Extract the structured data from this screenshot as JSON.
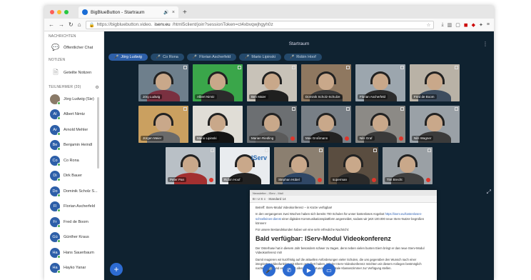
{
  "browser": {
    "tab_title": "BigBlueButton - Startraum",
    "new_tab": "+",
    "url_prefix": "https://bigbluebutton.video.",
    "url_domain": "iserv.eu",
    "url_rest": "/html5client/join?sessionToken=ct4xbvqwjhgyh0z"
  },
  "sidebar": {
    "messages_header": "NACHRICHTEN",
    "public_chat": "Öffentlicher Chat",
    "notes_header": "NOTIZEN",
    "shared_notes": "Geteilte Notizen",
    "participants_header": "TEILNEHMER (20)",
    "participants": [
      {
        "initials": "",
        "name": "Jörg Ludwig (Sie)",
        "photo": true
      },
      {
        "initials": "Al",
        "name": "Albert Nimtz"
      },
      {
        "initials": "Ar",
        "name": "Arnold Mehler"
      },
      {
        "initials": "Be",
        "name": "Benjamin Heindl"
      },
      {
        "initials": "Co",
        "name": "Co Rona"
      },
      {
        "initials": "Di",
        "name": "Dirk Bauer"
      },
      {
        "initials": "Do",
        "name": "Dominik Scholz S..."
      },
      {
        "initials": "Fl",
        "name": "Florian Ascherfeld"
      },
      {
        "initials": "Fr",
        "name": "Fred de Boom"
      },
      {
        "initials": "Gü",
        "name": "Günther Kraus"
      },
      {
        "initials": "Ha",
        "name": "Hans Sauerbaum"
      },
      {
        "initials": "Ha",
        "name": "Hayko Yanar"
      }
    ]
  },
  "main": {
    "room_title": "Startraum",
    "talking_chips": [
      "Jörg Ludwig",
      "Co Rona",
      "Florian Ascherfeld",
      "Mario Lipinski",
      "Robin Hoof"
    ],
    "video_rows": [
      [
        {
          "name": "Jörg Ludwig",
          "bg": "#6e7f8c",
          "shirt": "#7a3040",
          "mute": false
        },
        {
          "name": "Albert Nimtz",
          "bg": "#3aa64a",
          "shirt": "#2b2b2b",
          "mute": false
        },
        {
          "name": "Ben Maier",
          "bg": "#c8c2b8",
          "shirt": "#1f1f1f",
          "mute": false
        },
        {
          "name": "Dominik Scholz-Schulze",
          "bg": "#8f7860",
          "shirt": "#3a3a3a",
          "mute": false
        },
        {
          "name": "Florian Ascherfeld",
          "bg": "#9ca6ae",
          "shirt": "#2c2c2c",
          "mute": false
        },
        {
          "name": "Fred de Boom",
          "bg": "#b9b2a6",
          "shirt": "#3d4c5e",
          "mute": false
        }
      ],
      [
        {
          "name": "Jürgen Meier",
          "bg": "#caa060",
          "shirt": "#6a6a6a",
          "mute": false
        },
        {
          "name": "Mario Lipinski",
          "bg": "#e0ddd6",
          "shirt": "#141414",
          "mute": false
        },
        {
          "name": "Marian Riedling",
          "bg": "#6c6f72",
          "shirt": "#5a5a5a",
          "mute": true
        },
        {
          "name": "Max Großmann",
          "bg": "#787f86",
          "shirt": "#222",
          "mute": true
        },
        {
          "name": "Nils Graf",
          "bg": "#8c8a86",
          "shirt": "#3a3a3a",
          "mute": true
        },
        {
          "name": "Nils Wagner",
          "bg": "#9aa1a7",
          "shirt": "#3b3b3b",
          "mute": false
        }
      ],
      [
        {
          "name": "Peter Pan",
          "bg": "#b9c0c6",
          "shirt": "#a33030",
          "mute": true
        },
        {
          "name": "Robin Hoof",
          "bg": "#e9ecef",
          "shirt": "#222",
          "mute": false,
          "label": "IServ"
        },
        {
          "name": "Stephan Hübel",
          "bg": "#8b7f70",
          "shirt": "#2f4766",
          "mute": true
        },
        {
          "name": "superman",
          "bg": "#5a4d40",
          "shirt": "#2a2a2a",
          "mute": true
        },
        {
          "name": "Tim Brecht",
          "bg": "#9aa0a5",
          "shirt": "#404040",
          "mute": true
        }
      ]
    ],
    "share": {
      "window_title": "Newsletter - IServ - Mail",
      "toolbar_text": "B I U S  ≡  ·  Standard  14",
      "subject": "Betreff: IServ-Modul Videokonferenz – in Kürze verfügbar!",
      "intro": "In den vergangenen zwei Wochen haben sich bereits 700 Schulen für unser kostenloses Angebot",
      "link": "https://iserv.eu/kostenlosen-schnelleinen-dienst",
      "intro_tail": "einer digitalen Kommunikationsplattform angemeldet, sodass wir jetzt 100.000 neue IServ-Nutzer begrüßen können!",
      "note": "Für unsere Bestandskunden haben wir eine sehr erfreuliche Nachricht:",
      "heading": "Bald verfügbar: IServ-Modul Videokonferenz",
      "p1": "Der Osterhase hat in diesem Jahr besonders schwer zu tragen, denn neben vielen bunten Eiern bringt er das neue IServ-Modul Videokonferenz mit!",
      "p2": "Damit reagieren wir kurzfristig auf die aktuellen Anforderungen vieler Schulen, die uns gegenüber den Wunsch nach einer integrierten Videofunktion mit Eltern geäußert haben. Mit der IServ-Videokonferenz möchten wir diesem Anliegen bestmöglich nachkommen und es ab sofort allen unseren Kunden als digitale Klassenzimmer zur Verfügung stellen."
    }
  }
}
